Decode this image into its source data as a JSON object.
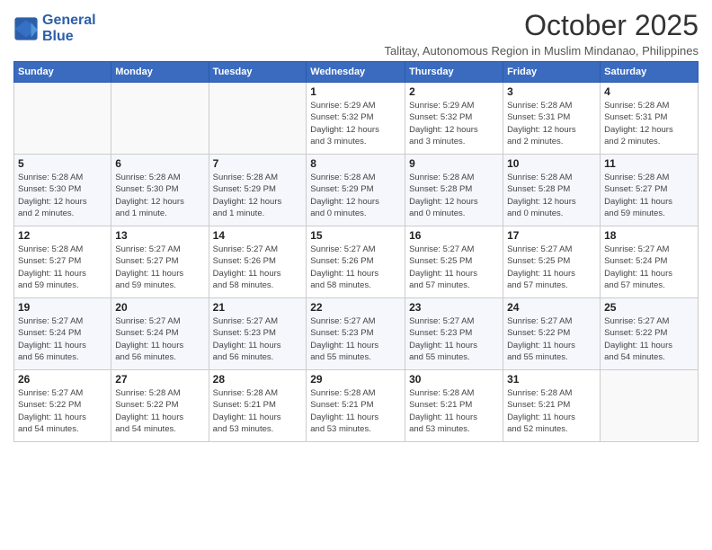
{
  "logo": {
    "line1": "General",
    "line2": "Blue"
  },
  "title": "October 2025",
  "subtitle": "Talitay, Autonomous Region in Muslim Mindanao, Philippines",
  "days_header": [
    "Sunday",
    "Monday",
    "Tuesday",
    "Wednesday",
    "Thursday",
    "Friday",
    "Saturday"
  ],
  "weeks": [
    [
      {
        "day": "",
        "info": ""
      },
      {
        "day": "",
        "info": ""
      },
      {
        "day": "",
        "info": ""
      },
      {
        "day": "1",
        "info": "Sunrise: 5:29 AM\nSunset: 5:32 PM\nDaylight: 12 hours\nand 3 minutes."
      },
      {
        "day": "2",
        "info": "Sunrise: 5:29 AM\nSunset: 5:32 PM\nDaylight: 12 hours\nand 3 minutes."
      },
      {
        "day": "3",
        "info": "Sunrise: 5:28 AM\nSunset: 5:31 PM\nDaylight: 12 hours\nand 2 minutes."
      },
      {
        "day": "4",
        "info": "Sunrise: 5:28 AM\nSunset: 5:31 PM\nDaylight: 12 hours\nand 2 minutes."
      }
    ],
    [
      {
        "day": "5",
        "info": "Sunrise: 5:28 AM\nSunset: 5:30 PM\nDaylight: 12 hours\nand 2 minutes."
      },
      {
        "day": "6",
        "info": "Sunrise: 5:28 AM\nSunset: 5:30 PM\nDaylight: 12 hours\nand 1 minute."
      },
      {
        "day": "7",
        "info": "Sunrise: 5:28 AM\nSunset: 5:29 PM\nDaylight: 12 hours\nand 1 minute."
      },
      {
        "day": "8",
        "info": "Sunrise: 5:28 AM\nSunset: 5:29 PM\nDaylight: 12 hours\nand 0 minutes."
      },
      {
        "day": "9",
        "info": "Sunrise: 5:28 AM\nSunset: 5:28 PM\nDaylight: 12 hours\nand 0 minutes."
      },
      {
        "day": "10",
        "info": "Sunrise: 5:28 AM\nSunset: 5:28 PM\nDaylight: 12 hours\nand 0 minutes."
      },
      {
        "day": "11",
        "info": "Sunrise: 5:28 AM\nSunset: 5:27 PM\nDaylight: 11 hours\nand 59 minutes."
      }
    ],
    [
      {
        "day": "12",
        "info": "Sunrise: 5:28 AM\nSunset: 5:27 PM\nDaylight: 11 hours\nand 59 minutes."
      },
      {
        "day": "13",
        "info": "Sunrise: 5:27 AM\nSunset: 5:27 PM\nDaylight: 11 hours\nand 59 minutes."
      },
      {
        "day": "14",
        "info": "Sunrise: 5:27 AM\nSunset: 5:26 PM\nDaylight: 11 hours\nand 58 minutes."
      },
      {
        "day": "15",
        "info": "Sunrise: 5:27 AM\nSunset: 5:26 PM\nDaylight: 11 hours\nand 58 minutes."
      },
      {
        "day": "16",
        "info": "Sunrise: 5:27 AM\nSunset: 5:25 PM\nDaylight: 11 hours\nand 57 minutes."
      },
      {
        "day": "17",
        "info": "Sunrise: 5:27 AM\nSunset: 5:25 PM\nDaylight: 11 hours\nand 57 minutes."
      },
      {
        "day": "18",
        "info": "Sunrise: 5:27 AM\nSunset: 5:24 PM\nDaylight: 11 hours\nand 57 minutes."
      }
    ],
    [
      {
        "day": "19",
        "info": "Sunrise: 5:27 AM\nSunset: 5:24 PM\nDaylight: 11 hours\nand 56 minutes."
      },
      {
        "day": "20",
        "info": "Sunrise: 5:27 AM\nSunset: 5:24 PM\nDaylight: 11 hours\nand 56 minutes."
      },
      {
        "day": "21",
        "info": "Sunrise: 5:27 AM\nSunset: 5:23 PM\nDaylight: 11 hours\nand 56 minutes."
      },
      {
        "day": "22",
        "info": "Sunrise: 5:27 AM\nSunset: 5:23 PM\nDaylight: 11 hours\nand 55 minutes."
      },
      {
        "day": "23",
        "info": "Sunrise: 5:27 AM\nSunset: 5:23 PM\nDaylight: 11 hours\nand 55 minutes."
      },
      {
        "day": "24",
        "info": "Sunrise: 5:27 AM\nSunset: 5:22 PM\nDaylight: 11 hours\nand 55 minutes."
      },
      {
        "day": "25",
        "info": "Sunrise: 5:27 AM\nSunset: 5:22 PM\nDaylight: 11 hours\nand 54 minutes."
      }
    ],
    [
      {
        "day": "26",
        "info": "Sunrise: 5:27 AM\nSunset: 5:22 PM\nDaylight: 11 hours\nand 54 minutes."
      },
      {
        "day": "27",
        "info": "Sunrise: 5:28 AM\nSunset: 5:22 PM\nDaylight: 11 hours\nand 54 minutes."
      },
      {
        "day": "28",
        "info": "Sunrise: 5:28 AM\nSunset: 5:21 PM\nDaylight: 11 hours\nand 53 minutes."
      },
      {
        "day": "29",
        "info": "Sunrise: 5:28 AM\nSunset: 5:21 PM\nDaylight: 11 hours\nand 53 minutes."
      },
      {
        "day": "30",
        "info": "Sunrise: 5:28 AM\nSunset: 5:21 PM\nDaylight: 11 hours\nand 53 minutes."
      },
      {
        "day": "31",
        "info": "Sunrise: 5:28 AM\nSunset: 5:21 PM\nDaylight: 11 hours\nand 52 minutes."
      },
      {
        "day": "",
        "info": ""
      }
    ]
  ]
}
